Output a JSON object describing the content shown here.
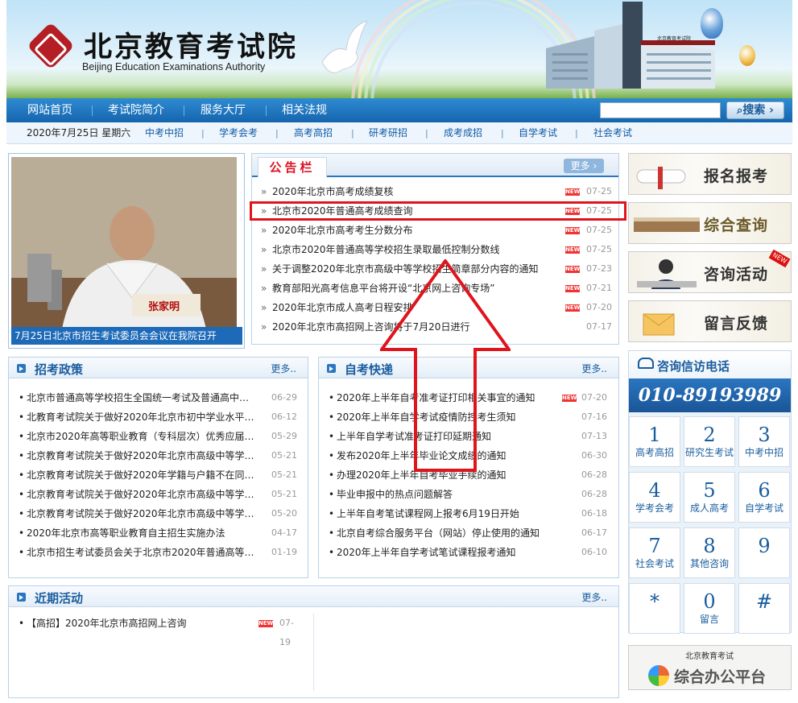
{
  "banner": {
    "title": "北京教育考试院",
    "subtitle": "Beijing Education Examinations Authority",
    "building_sign": "北京教育考试院"
  },
  "nav": {
    "items": [
      "网站首页",
      "考试院简介",
      "服务大厅",
      "相关法规"
    ],
    "search_placeholder": "",
    "search_label": "搜索"
  },
  "subnav": {
    "date": "2020年7月25日 星期六",
    "items": [
      "中考中招",
      "学考会考",
      "高考高招",
      "研考研招",
      "成考成招",
      "自学考试",
      "社会考试"
    ]
  },
  "photo": {
    "caption": "7月25日北京市招生考试委员会会议在我院召开",
    "nameplate": "张家明"
  },
  "notice": {
    "title": "公告栏",
    "more": "更多",
    "items": [
      {
        "title": "2020年北京市高考成绩复核",
        "date": "07-25",
        "new": true
      },
      {
        "title": "北京市2020年普通高考成绩查询",
        "date": "07-25",
        "new": true
      },
      {
        "title": "2020年北京市高考考生分数分布",
        "date": "07-25",
        "new": true
      },
      {
        "title": "北京市2020年普通高等学校招生录取最低控制分数线",
        "date": "07-25",
        "new": true
      },
      {
        "title": "关于调整2020年北京市高级中等学校招生简章部分内容的通知",
        "date": "07-23",
        "new": true
      },
      {
        "title": "教育部阳光高考信息平台将开设“北京网上咨询专场”",
        "date": "07-21",
        "new": true
      },
      {
        "title": "2020年北京市成人高考日程安排",
        "date": "07-20",
        "new": true
      },
      {
        "title": "2020年北京市高招网上咨询将于7月20日进行",
        "date": "07-17",
        "new": false
      }
    ]
  },
  "policy": {
    "title": "招考政策",
    "more": "更多..",
    "items": [
      {
        "title": "北京市普通高等学校招生全国统一考试及普通高中…",
        "date": "06-29"
      },
      {
        "title": "北教育考试院关于做好2020年北京市初中学业水平…",
        "date": "06-12"
      },
      {
        "title": "北京市2020年高等职业教育（专科层次）优秀应届…",
        "date": "05-29"
      },
      {
        "title": "北京教育考试院关于做好2020年北京市高级中等学…",
        "date": "05-21"
      },
      {
        "title": "北京教育考试院关于做好2020年学籍与户籍不在同…",
        "date": "05-21"
      },
      {
        "title": "北京教育考试院关于做好2020年北京市高级中等学…",
        "date": "05-21"
      },
      {
        "title": "北京教育考试院关于做好2020年北京市高级中等学…",
        "date": "05-20"
      },
      {
        "title": "2020年北京市高等职业教育自主招生实施办法",
        "date": "04-17"
      },
      {
        "title": "北京市招生考试委员会关于北京市2020年普通高等…",
        "date": "01-19"
      }
    ]
  },
  "zikao": {
    "title": "自考快递",
    "more": "更多..",
    "items": [
      {
        "title": "2020年上半年自考准考证打印相关事宜的通知",
        "date": "07-20",
        "new": true
      },
      {
        "title": "2020年上半年自学考试疫情防控考生须知",
        "date": "07-16",
        "new": false
      },
      {
        "title": "上半年自学考试准考证打印延期通知",
        "date": "07-13",
        "new": false
      },
      {
        "title": "发布2020年上半年毕业论文成绩的通知",
        "date": "06-30",
        "new": false
      },
      {
        "title": "办理2020年上半年自考毕业手续的通知",
        "date": "06-28",
        "new": false
      },
      {
        "title": "毕业申报中的热点问题解答",
        "date": "06-28",
        "new": false
      },
      {
        "title": "上半年自考笔试课程网上报考6月19日开始",
        "date": "06-18",
        "new": false
      },
      {
        "title": "北京自考综合服务平台（网站）停止使用的通知",
        "date": "06-17",
        "new": false
      },
      {
        "title": "2020年上半年自学考试笔试课程报考通知",
        "date": "06-10",
        "new": false
      }
    ]
  },
  "activities": {
    "title": "近期活动",
    "more": "更多..",
    "items": [
      {
        "title": "【高招】2020年北京市高招网上咨询",
        "date": "07-19",
        "new": true
      }
    ]
  },
  "new_badge": "NEW",
  "side": {
    "buttons": [
      "报名报考",
      "综合查询",
      "咨询活动",
      "留言反馈"
    ],
    "hotline_title": "咨询信访电话",
    "hotline_number": "010-89193989",
    "keys": [
      {
        "n": "1",
        "l": "高考高招"
      },
      {
        "n": "2",
        "l": "研究生考试"
      },
      {
        "n": "3",
        "l": "中考中招"
      },
      {
        "n": "4",
        "l": "学考会考"
      },
      {
        "n": "5",
        "l": "成人高考"
      },
      {
        "n": "6",
        "l": "自学考试"
      },
      {
        "n": "7",
        "l": "社会考试"
      },
      {
        "n": "8",
        "l": "其他咨询"
      },
      {
        "n": "9",
        "l": ""
      },
      {
        "n": "*",
        "l": ""
      },
      {
        "n": "0",
        "l": "留言"
      },
      {
        "n": "#",
        "l": ""
      }
    ],
    "office_small": "北京教育考试",
    "office_label": "综合办公平台"
  },
  "colors": {
    "primary": "#1565ad",
    "highlight": "#e0141c",
    "arrow": "#e0141c"
  }
}
